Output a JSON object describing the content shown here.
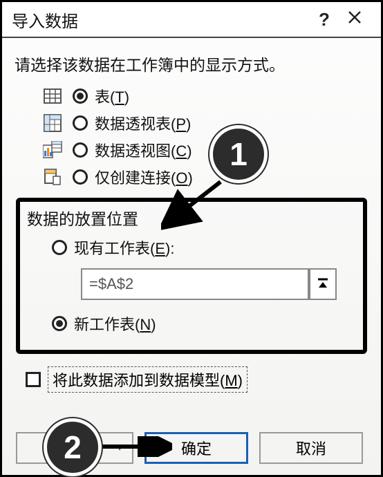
{
  "title": "导入数据",
  "prompt": "请选择该数据在工作簿中的显示方式。",
  "display_options": {
    "table": {
      "label": "表",
      "hotkey": "T",
      "selected": true
    },
    "pivot_table": {
      "label": "数据透视表",
      "hotkey": "P",
      "selected": false
    },
    "pivot_chart": {
      "label": "数据透视图",
      "hotkey": "C",
      "selected": false
    },
    "conn_only": {
      "label": "仅创建连接",
      "hotkey": "O",
      "selected": false
    }
  },
  "placement": {
    "section_label": "数据的放置位置",
    "existing": {
      "label": "现有工作表",
      "hotkey": "E",
      "selected": false
    },
    "ref_value": "=$A$2",
    "new_sheet": {
      "label": "新工作表",
      "hotkey": "N",
      "selected": true
    }
  },
  "checkbox": {
    "label": "将此数据添加到数据模型",
    "hotkey": "M",
    "checked": false
  },
  "buttons": {
    "properties": "",
    "ok": "确定",
    "cancel": "取消"
  },
  "annotations": {
    "badge1": "1",
    "badge2": "2"
  }
}
